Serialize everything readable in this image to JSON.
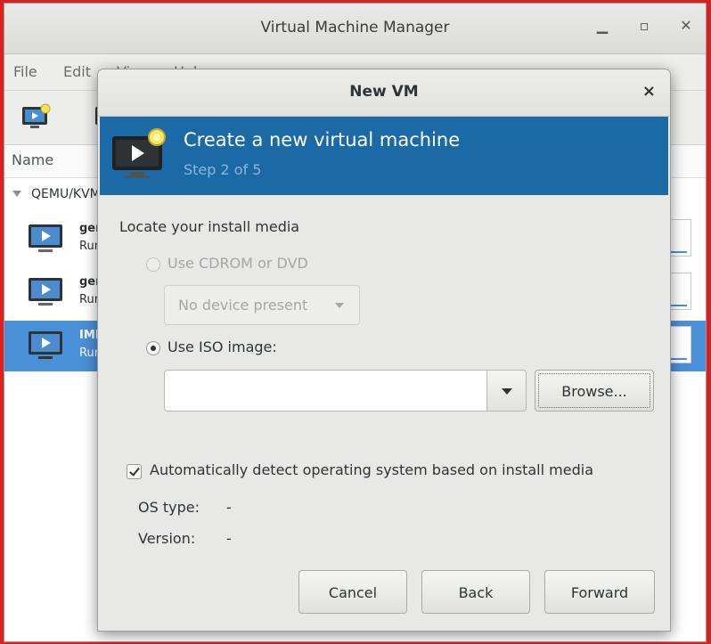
{
  "main_window": {
    "title": "Virtual Machine Manager",
    "menu": [
      "File",
      "Edit",
      "View",
      "Help"
    ],
    "list_header": "Name",
    "connection": "QEMU/KVM",
    "vms": [
      {
        "name": "generic",
        "status": "Running",
        "selected": false
      },
      {
        "name": "generic",
        "status": "Running",
        "selected": false
      },
      {
        "name": "IMPORT",
        "status": "Running",
        "selected": true
      }
    ]
  },
  "dialog": {
    "title": "New VM",
    "close_glyph": "×",
    "banner": {
      "title": "Create a new virtual machine",
      "step": "Step 2 of 5"
    },
    "locate_label": "Locate your install media",
    "options": {
      "cdrom_label": "Use CDROM or DVD",
      "cdrom_device": "No device present",
      "iso_label": "Use ISO image:",
      "iso_value": "",
      "browse_label": "Browse..."
    },
    "auto_detect_label": "Automatically detect operating system based on install media",
    "os_type_label": "OS type:",
    "os_type_value": "-",
    "version_label": "Version:",
    "version_value": "-",
    "buttons": {
      "cancel": "Cancel",
      "back": "Back",
      "forward": "Forward"
    }
  },
  "colors": {
    "banner": "#1b6aa5",
    "selection": "#4a90d9",
    "desktop": "#d92121"
  }
}
